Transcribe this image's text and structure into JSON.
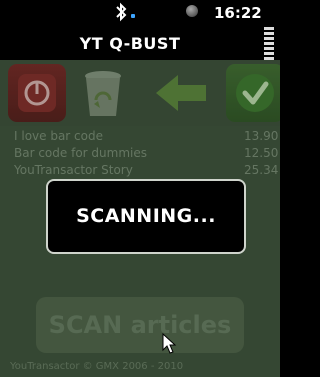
{
  "status_bar": {
    "bluetooth_icon": "bluetooth-icon",
    "time": "16:22",
    "battery_icon": "battery-icon"
  },
  "app": {
    "title": "YT Q-BUST"
  },
  "toolbar": {
    "buttons": [
      {
        "icon": "stop-icon",
        "color": "#7a2020"
      },
      {
        "icon": "recycle-bin-icon",
        "color": "#7f8d78"
      },
      {
        "icon": "back-arrow-icon",
        "color": "#5e8a3a"
      },
      {
        "icon": "checkmark-icon",
        "color": "#2c5320"
      }
    ]
  },
  "articles": [
    {
      "name": "I love bar code",
      "price": "13.90"
    },
    {
      "name": "Bar code for dummies",
      "price": "12.50"
    },
    {
      "name": "YouTransactor Story",
      "price": "25.34"
    }
  ],
  "scan_button": {
    "label": "SCAN articles"
  },
  "dialog": {
    "text": "SCANNING..."
  },
  "footer": {
    "text": "YouTransactor © GMX 2006 - 2010"
  },
  "colors": {
    "background": "#3b4e38",
    "title_bar": "#000000",
    "dialog_border": "#cfd4cc"
  }
}
